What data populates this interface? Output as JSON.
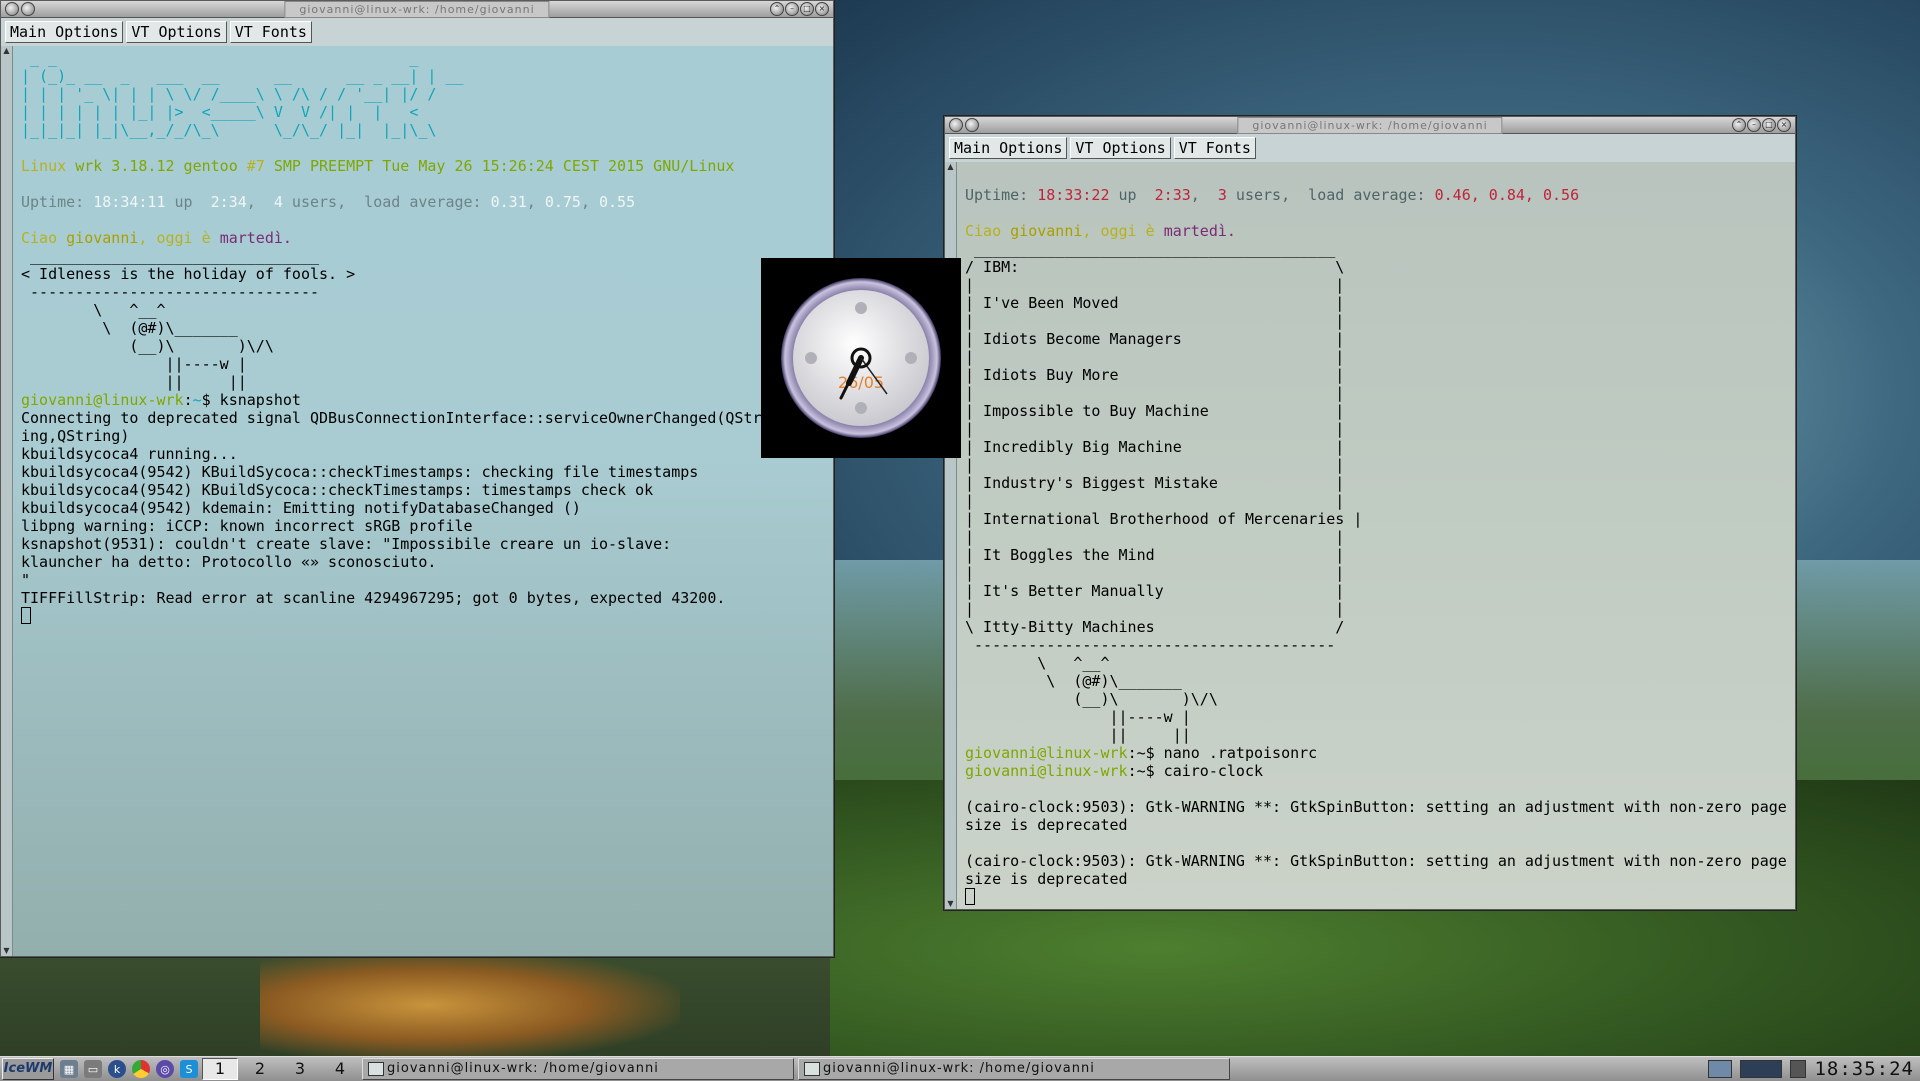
{
  "term_left": {
    "title": "giovanni@linux-wrk: /home/giovanni",
    "menu": [
      "Main Options",
      "VT Options",
      "VT Fonts"
    ],
    "lines": [
      [
        {
          "t": " _ _                                       _",
          "c": "c-cyan"
        }
      ],
      [
        {
          "t": "| (_)_ __  _   ___  __      __      __ _ __| | __",
          "c": "c-cyan"
        }
      ],
      [
        {
          "t": "| | | '_ \\| | | \\ \\/ /____\\ \\ /\\ / / '__| |/ /",
          "c": "c-cyan"
        }
      ],
      [
        {
          "t": "| | | | | | |_| |>  <_____\\ V  V /| |  |   <",
          "c": "c-cyan"
        }
      ],
      [
        {
          "t": "|_|_|_| |_|\\__,_/_/\\_\\      \\_/\\_/ |_|  |_|\\_\\",
          "c": "c-cyan"
        }
      ],
      [],
      [
        {
          "t": "Linux ",
          "c": "c-yellow2"
        },
        {
          "t": "wrk 3.18.12 gentoo ",
          "c": "c-green"
        },
        {
          "t": "#7 ",
          "c": "c-yellow2"
        },
        {
          "t": "SMP PREEMPT Tue May 26 15:26:24 CEST 2015 GNU/Linux",
          "c": "c-green"
        }
      ],
      [],
      [
        {
          "t": "Uptime: ",
          "c": "c-gray"
        },
        {
          "t": "18:34:11",
          "c": "c-white"
        },
        {
          "t": " up  ",
          "c": "c-gray"
        },
        {
          "t": "2:34",
          "c": "c-white"
        },
        {
          "t": ",  ",
          "c": "c-gray"
        },
        {
          "t": "4",
          "c": "c-white"
        },
        {
          "t": " users,  load average: ",
          "c": "c-gray"
        },
        {
          "t": "0.31",
          "c": "c-white"
        },
        {
          "t": ", ",
          "c": "c-gray"
        },
        {
          "t": "0.75",
          "c": "c-white"
        },
        {
          "t": ", ",
          "c": "c-gray"
        },
        {
          "t": "0.55",
          "c": "c-white"
        }
      ],
      [],
      [
        {
          "t": "Ciao ",
          "c": "c-yellow2"
        },
        {
          "t": "giovanni",
          "c": "c-yellow"
        },
        {
          "t": ", oggi è ",
          "c": "c-yellow2"
        },
        {
          "t": "martedì.",
          "c": "c-purple"
        }
      ],
      [
        {
          "t": " ________________________________"
        }
      ],
      [
        {
          "t": "< Idleness is the holiday of fools. >"
        }
      ],
      [
        {
          "t": " --------------------------------"
        }
      ],
      [
        {
          "t": "        \\   ^__^"
        }
      ],
      [
        {
          "t": "         \\  (@#)\\_______"
        }
      ],
      [
        {
          "t": "            (__)\\       )\\/\\"
        }
      ],
      [
        {
          "t": "                ||----w |"
        }
      ],
      [
        {
          "t": "                ||     ||"
        }
      ],
      [
        {
          "t": "giovanni@linux-wrk",
          "c": "c-green"
        },
        {
          "t": ":",
          "c": ""
        },
        {
          "t": "~",
          "c": "c-cyan"
        },
        {
          "t": "$ ksnapshot"
        }
      ],
      [
        {
          "t": "Connecting to deprecated signal QDBusConnectionInterface::serviceOwnerChanged(QStr"
        }
      ],
      [
        {
          "t": "ing,QString)"
        }
      ],
      [
        {
          "t": "kbuildsycoca4 running..."
        }
      ],
      [
        {
          "t": "kbuildsycoca4(9542) KBuildSycoca::checkTimestamps: checking file timestamps"
        }
      ],
      [
        {
          "t": "kbuildsycoca4(9542) KBuildSycoca::checkTimestamps: timestamps check ok"
        }
      ],
      [
        {
          "t": "kbuildsycoca4(9542) kdemain: Emitting notifyDatabaseChanged ()"
        }
      ],
      [
        {
          "t": "libpng warning: iCCP: known incorrect sRGB profile"
        }
      ],
      [
        {
          "t": "ksnapshot(9531): couldn't create slave: \"Impossibile creare un io-slave:"
        }
      ],
      [
        {
          "t": "klauncher ha detto: Protocollo «» sconosciuto."
        }
      ],
      [
        {
          "t": "\""
        }
      ],
      [
        {
          "t": "TIFFFillStrip: Read error at scanline 4294967295; got 0 bytes, expected 43200."
        }
      ]
    ]
  },
  "term_right": {
    "title": "giovanni@linux-wrk: /home/giovanni",
    "menu": [
      "Main Options",
      "VT Options",
      "VT Fonts"
    ],
    "lines": [
      [
        {
          "t": "Uptime: ",
          "c": "c-darkgray"
        },
        {
          "t": "18:33:22",
          "c": "c-red"
        },
        {
          "t": " up  ",
          "c": "c-darkgray"
        },
        {
          "t": "2:33",
          "c": "c-red"
        },
        {
          "t": ",  ",
          "c": "c-darkgray"
        },
        {
          "t": "3",
          "c": "c-red"
        },
        {
          "t": " users,  load average: ",
          "c": "c-darkgray"
        },
        {
          "t": "0.46, 0.84, 0.56",
          "c": "c-red"
        }
      ],
      [],
      [
        {
          "t": "Ciao ",
          "c": "c-yellow2"
        },
        {
          "t": "giovanni",
          "c": "c-yellow"
        },
        {
          "t": ", oggi è ",
          "c": "c-yellow2"
        },
        {
          "t": "martedì.",
          "c": "c-purple"
        }
      ],
      [
        {
          "t": " ________________________________________"
        }
      ],
      [
        {
          "t": "/ IBM:                                   \\"
        }
      ],
      [
        {
          "t": "|                                        |"
        }
      ],
      [
        {
          "t": "| I've Been Moved                        |"
        }
      ],
      [
        {
          "t": "|                                        |"
        }
      ],
      [
        {
          "t": "| Idiots Become Managers                 |"
        }
      ],
      [
        {
          "t": "|                                        |"
        }
      ],
      [
        {
          "t": "| Idiots Buy More                        |"
        }
      ],
      [
        {
          "t": "|                                        |"
        }
      ],
      [
        {
          "t": "| Impossible to Buy Machine              |"
        }
      ],
      [
        {
          "t": "|                                        |"
        }
      ],
      [
        {
          "t": "| Incredibly Big Machine                 |"
        }
      ],
      [
        {
          "t": "|                                        |"
        }
      ],
      [
        {
          "t": "| Industry's Biggest Mistake             |"
        }
      ],
      [
        {
          "t": "|                                        |"
        }
      ],
      [
        {
          "t": "| International Brotherhood of Mercenaries |"
        }
      ],
      [
        {
          "t": "|                                        |"
        }
      ],
      [
        {
          "t": "| It Boggles the Mind                    |"
        }
      ],
      [
        {
          "t": "|                                        |"
        }
      ],
      [
        {
          "t": "| It's Better Manually                   |"
        }
      ],
      [
        {
          "t": "|                                        |"
        }
      ],
      [
        {
          "t": "\\ Itty-Bitty Machines                    /"
        }
      ],
      [
        {
          "t": " ----------------------------------------"
        }
      ],
      [
        {
          "t": "        \\   ^__^"
        }
      ],
      [
        {
          "t": "         \\  (@#)\\_______"
        }
      ],
      [
        {
          "t": "            (__)\\       )\\/\\"
        }
      ],
      [
        {
          "t": "                ||----w |"
        }
      ],
      [
        {
          "t": "                ||     ||"
        }
      ],
      [
        {
          "t": "giovanni@linux-wrk",
          "c": "c-green"
        },
        {
          "t": ":~$ nano .ratpoisonrc"
        }
      ],
      [
        {
          "t": "giovanni@linux-wrk",
          "c": "c-green"
        },
        {
          "t": ":~$ cairo-clock"
        }
      ],
      [],
      [
        {
          "t": "(cairo-clock:9503): Gtk-WARNING **: GtkSpinButton: setting an adjustment with non-zero page"
        }
      ],
      [
        {
          "t": "size is deprecated"
        }
      ],
      [],
      [
        {
          "t": "(cairo-clock:9503): Gtk-WARNING **: GtkSpinButton: setting an adjustment with non-zero page"
        }
      ],
      [
        {
          "t": "size is deprecated"
        }
      ]
    ]
  },
  "clock": {
    "date": "26/05",
    "time": "18:34"
  },
  "taskbar": {
    "start_label": "IceWM",
    "workspaces": [
      "1",
      "2",
      "3",
      "4"
    ],
    "active_workspace": "1",
    "tasks": [
      "giovanni@linux-wrk: /home/giovanni",
      "giovanni@linux-wrk: /home/giovanni"
    ],
    "clock": "18:35:24",
    "icons": [
      "window-list-icon",
      "show-desktop-icon",
      "konqueror-icon",
      "chrome-icon",
      "browser-icon",
      "skype-icon"
    ]
  },
  "colors": {
    "accent_cyan": "#11a5b8",
    "prompt_green": "#7fa700",
    "uptime_red": "#c0233a",
    "day_purple": "#7a2b76"
  }
}
